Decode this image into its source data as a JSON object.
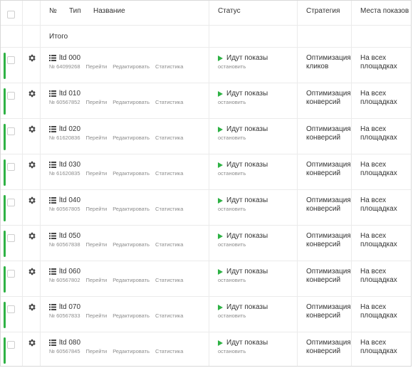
{
  "header": {
    "num": "№",
    "type": "Тип",
    "name": "Название",
    "status": "Статус",
    "strategy": "Стратегия",
    "places": "Места показов"
  },
  "total": {
    "label": "Итого"
  },
  "actions": {
    "go": "Перейти",
    "edit": "Редактировать",
    "stats": "Статистика"
  },
  "rows": [
    {
      "title": "ltd 000",
      "num": "№ 64099268",
      "status": "Идут показы",
      "stop": "остановить",
      "strategy1": "Оптимизация",
      "strategy2": "кликов",
      "places1": "На всех",
      "places2": "площадках"
    },
    {
      "title": "ltd 010",
      "num": "№ 60567852",
      "status": "Идут показы",
      "stop": "остановить",
      "strategy1": "Оптимизация",
      "strategy2": "конверсий",
      "places1": "На всех",
      "places2": "площадках"
    },
    {
      "title": "ltd 020",
      "num": "№ 61620836",
      "status": "Идут показы",
      "stop": "остановить",
      "strategy1": "Оптимизация",
      "strategy2": "конверсий",
      "places1": "На всех",
      "places2": "площадках"
    },
    {
      "title": "ltd 030",
      "num": "№ 61620835",
      "status": "Идут показы",
      "stop": "остановить",
      "strategy1": "Оптимизация",
      "strategy2": "конверсий",
      "places1": "На всех",
      "places2": "площадках"
    },
    {
      "title": "ltd 040",
      "num": "№ 60567805",
      "status": "Идут показы",
      "stop": "остановить",
      "strategy1": "Оптимизация",
      "strategy2": "конверсий",
      "places1": "На всех",
      "places2": "площадках"
    },
    {
      "title": "ltd 050",
      "num": "№ 60567838",
      "status": "Идут показы",
      "stop": "остановить",
      "strategy1": "Оптимизация",
      "strategy2": "конверсий",
      "places1": "На всех",
      "places2": "площадках"
    },
    {
      "title": "ltd 060",
      "num": "№ 60567802",
      "status": "Идут показы",
      "stop": "остановить",
      "strategy1": "Оптимизация",
      "strategy2": "конверсий",
      "places1": "На всех",
      "places2": "площадках"
    },
    {
      "title": "ltd 070",
      "num": "№ 60567833",
      "status": "Идут показы",
      "stop": "остановить",
      "strategy1": "Оптимизация",
      "strategy2": "конверсий",
      "places1": "На всех",
      "places2": "площадках"
    },
    {
      "title": "ltd 080",
      "num": "№ 60567845",
      "status": "Идут показы",
      "stop": "остановить",
      "strategy1": "Оптимизация",
      "strategy2": "конверсий",
      "places1": "На всех",
      "places2": "площадках"
    }
  ],
  "colors": {
    "active": "#2fb245",
    "muted": "#8c8c8c",
    "border": "#ebebeb"
  }
}
